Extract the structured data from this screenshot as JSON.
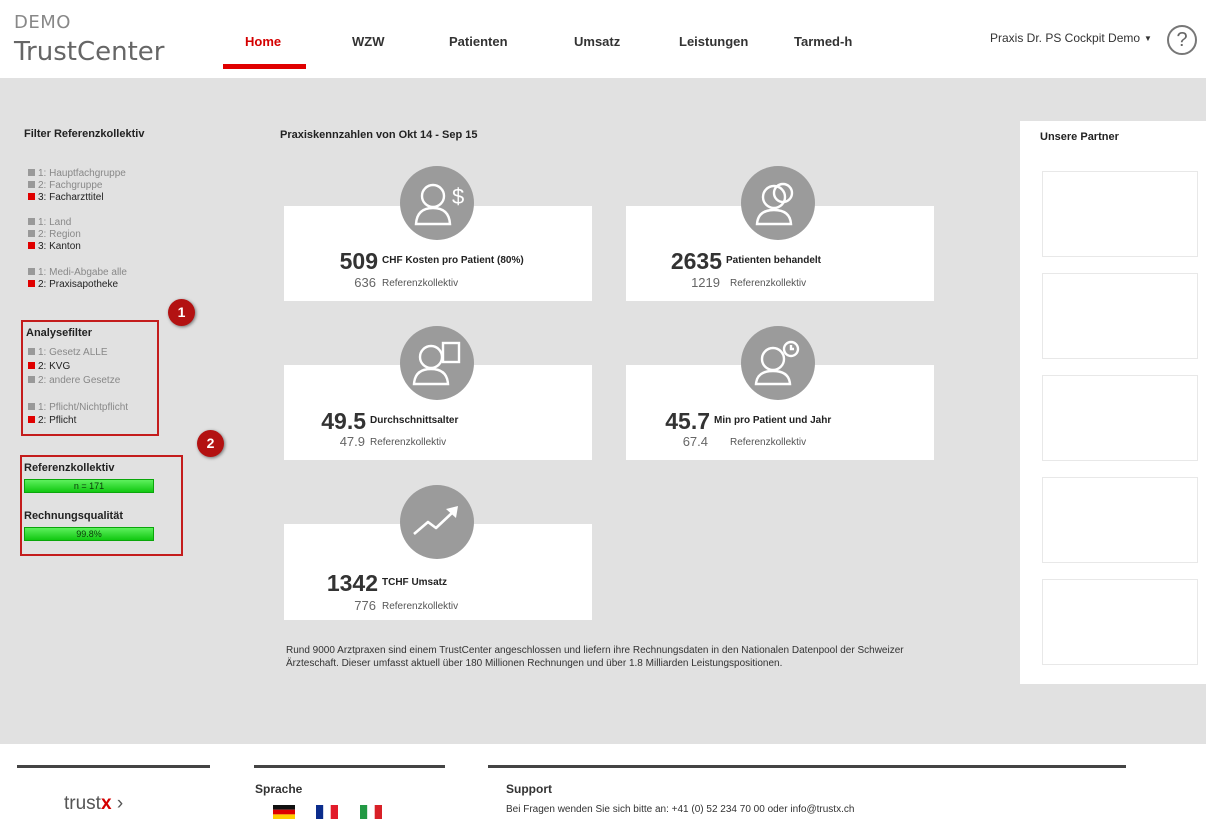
{
  "header": {
    "logo_demo": "DEMO",
    "logo_main": "TrustCenter",
    "nav": [
      "Home",
      "WZW",
      "Patienten",
      "Umsatz",
      "Leistungen",
      "Tarmed-h"
    ],
    "active_nav": "Home",
    "user_menu": "Praxis Dr. PS Cockpit Demo",
    "help": "?"
  },
  "filter": {
    "title": "Filter Referenzkollektiv",
    "groups": [
      [
        {
          "label": "1: Hauptfachgruppe",
          "on": false
        },
        {
          "label": "2: Fachgruppe",
          "on": false
        },
        {
          "label": "3: Facharzttitel",
          "on": true
        }
      ],
      [
        {
          "label": "1: Land",
          "on": false
        },
        {
          "label": "2: Region",
          "on": false
        },
        {
          "label": "3: Kanton",
          "on": true
        }
      ],
      [
        {
          "label": "1: Medi-Abgabe alle",
          "on": false
        },
        {
          "label": "2: Praxisapotheke",
          "on": true
        }
      ]
    ]
  },
  "analyse": {
    "title": "Analysefilter",
    "groups": [
      [
        {
          "label": "1: Gesetz ALLE",
          "on": false
        },
        {
          "label": "2: KVG",
          "on": true
        },
        {
          "label": "2: andere Gesetze",
          "on": false
        }
      ],
      [
        {
          "label": "1: Pflicht/Nichtpflicht",
          "on": false
        },
        {
          "label": "2: Pflicht",
          "on": true
        }
      ]
    ]
  },
  "markers": [
    "1",
    "2"
  ],
  "referenz": {
    "title": "Referenzkollektiv",
    "value": "n = 171"
  },
  "qualitaet": {
    "title": "Rechnungsqualität",
    "value": "99.8%"
  },
  "main_title": "Praxiskennzahlen von Okt 14 - Sep 15",
  "ref_label": "Referenzkollektiv",
  "kpis": [
    {
      "value": "509",
      "label": "CHF Kosten pro Patient (80%)",
      "ref": "636",
      "icon": "patient-cost-icon"
    },
    {
      "value": "2635",
      "label": "Patienten behandelt",
      "ref": "1219",
      "icon": "patients-group-icon"
    },
    {
      "value": "49.5",
      "label": "Durchschnittsalter",
      "ref": "47.9",
      "icon": "patient-age-icon"
    },
    {
      "value": "45.7",
      "label": "Min pro Patient und Jahr",
      "ref": "67.4",
      "icon": "patient-time-icon"
    },
    {
      "value": "1342",
      "label": "TCHF Umsatz",
      "ref": "776",
      "icon": "trend-up-icon"
    }
  ],
  "footnote": "Rund 9000 Arztpraxen sind einem TrustCenter angeschlossen und liefern ihre Rechnungsdaten in den Nationalen Datenpool der Schweizer Ärzteschaft. Dieser umfasst aktuell über 180 Millionen Rechnungen und über 1.8 Milliarden Leistungspositionen.",
  "partners": {
    "title": "Unsere Partner"
  },
  "footer": {
    "logo_main": "trust",
    "logo_x": "x",
    "logo_arrow": "›",
    "sprache": "Sprache",
    "support": "Support",
    "support_text": "Bei Fragen wenden Sie sich bitte an: +41 (0) 52 234 70 00 oder info@trustx.ch",
    "flags": [
      "german-flag",
      "french-flag",
      "italian-flag"
    ]
  }
}
